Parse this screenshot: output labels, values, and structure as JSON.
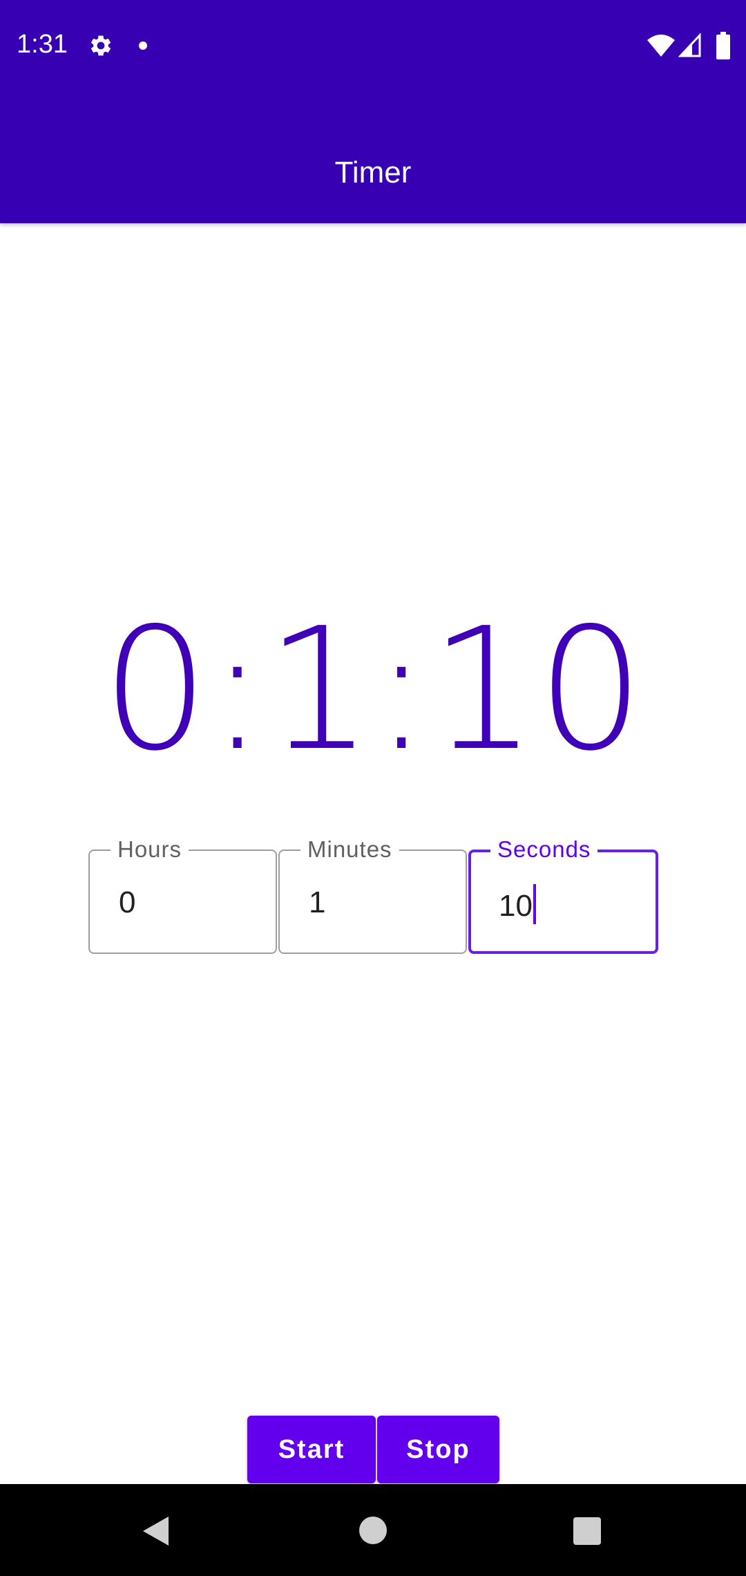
{
  "status_bar": {
    "time": "1:31",
    "icons": [
      "gear-icon",
      "notification-dot-icon",
      "wifi-icon",
      "cell-signal-icon",
      "battery-icon"
    ]
  },
  "app_bar": {
    "title": "Timer",
    "color": "#3700b3"
  },
  "timer": {
    "display": "0:1:10",
    "color": "#3f00b8"
  },
  "fields": {
    "hours": {
      "label": "Hours",
      "value": "0"
    },
    "minutes": {
      "label": "Minutes",
      "value": "1"
    },
    "seconds": {
      "label": "Seconds",
      "value": "10",
      "focused": true
    }
  },
  "buttons": {
    "start": "Start",
    "stop": "Stop",
    "color": "#6200ee"
  },
  "nav_bar": {
    "icons": [
      "back-icon",
      "home-icon",
      "recents-icon"
    ]
  }
}
